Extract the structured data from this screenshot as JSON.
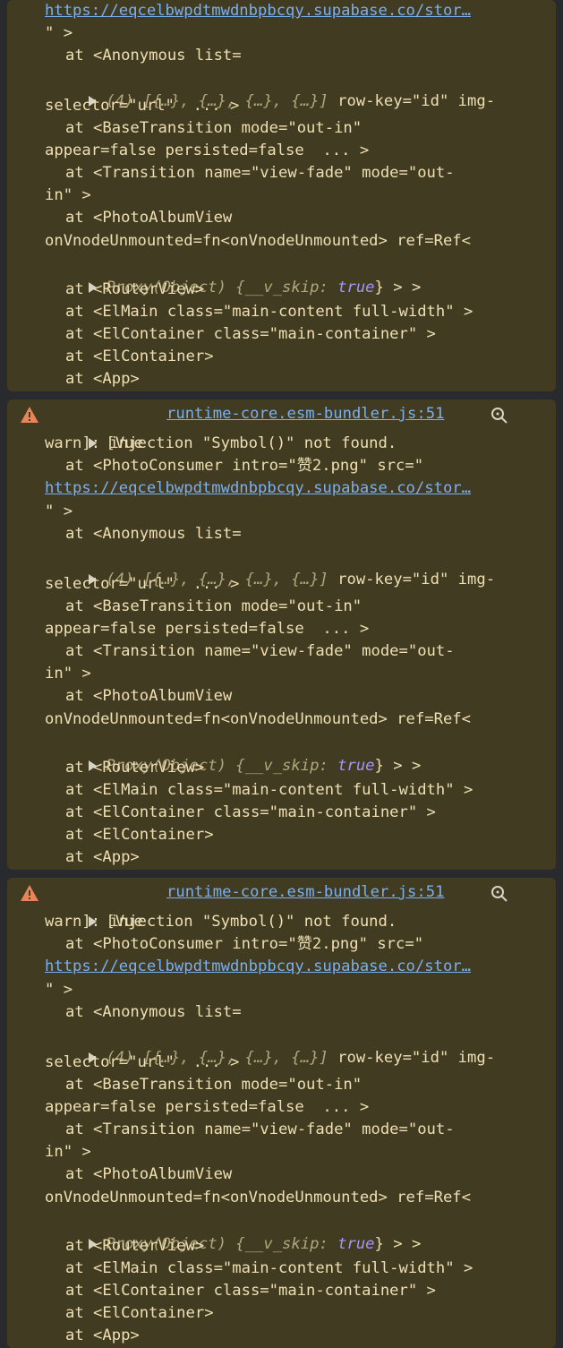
{
  "colors": {
    "warning_bg": "#413b22",
    "text": "#f0dfb3",
    "link": "#79b0f2",
    "keyword": "#a693ff",
    "panel_bg": "#292a2d"
  },
  "icons": {
    "warning": "warning-icon",
    "expand": "expand-triangle-icon",
    "search": "search-icon"
  },
  "top_fragment": {
    "url": "https://eqcelbwpdtmwdnbpbcqy.supabase.co/stor…",
    "lines": [
      "\" >",
      "at <Anonymous list=",
      "(4)",
      "[{…}, {…}, {…}, {…}]",
      "row-key=\"id\" img-",
      "selector=\"url\"  ... >",
      "at <BaseTransition mode=\"out-in\"",
      "appear=false persisted=false  ... >",
      "at <Transition name=\"view-fade\" mode=\"out-",
      "in\" >",
      "at <PhotoAlbumView",
      "onVnodeUnmounted=fn<onVnodeUnmounted> ref=Ref<",
      "Proxy(Object)",
      "{__v_skip:",
      "true",
      "} > >",
      "at <RouterView>",
      "at <ElMain class=\"main-content full-width\" >",
      "at <ElContainer class=\"main-container\" >",
      "at <ElContainer>",
      "at <App>"
    ]
  },
  "messages": [
    {
      "head": "[Vue",
      "source": "runtime-core.esm-bundler.js:51",
      "warn": "warn]: injection \"Symbol()\" not found.",
      "consumer": "at <PhotoConsumer intro=\"赞2.png\" src=\"",
      "url": "https://eqcelbwpdtmwdnbpbcqy.supabase.co/stor…"
    },
    {
      "head": "[Vue",
      "source": "runtime-core.esm-bundler.js:51",
      "warn": "warn]: injection \"Symbol()\" not found.",
      "consumer": "at <PhotoConsumer intro=\"赞2.png\" src=\"",
      "url": "https://eqcelbwpdtmwdnbpbcqy.supabase.co/stor…"
    }
  ]
}
